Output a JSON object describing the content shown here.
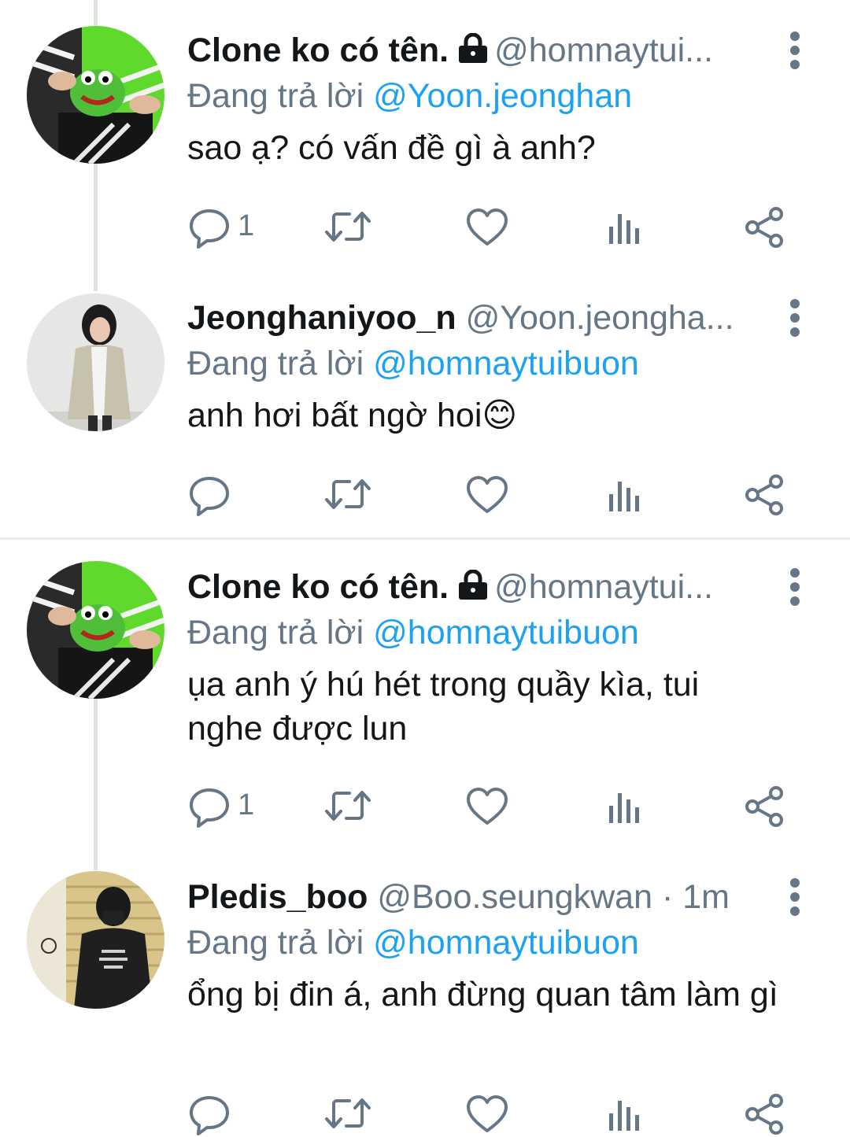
{
  "tweets": [
    {
      "display_name": "Clone ko có tên.",
      "locked": true,
      "handle": "@homnaytui...",
      "reply_prefix": "Đang trả lời",
      "reply_mention": "@Yoon.jeonghan",
      "text": "sao ạ? có vấn đề gì à anh?",
      "reply_count": "1",
      "avatar": "kermit-frog-avatar"
    },
    {
      "display_name": "Jeonghaniyoo_n",
      "locked": false,
      "handle": "@Yoon.jeongha...",
      "reply_prefix": "Đang trả lời",
      "reply_mention": "@homnaytuibuon",
      "text": "anh hơi bất ngờ hoi😊",
      "reply_count": "",
      "avatar": "person-cardigan-avatar"
    },
    {
      "display_name": "Clone ko có tên.",
      "locked": true,
      "handle": "@homnaytui...",
      "reply_prefix": "Đang trả lời",
      "reply_mention": "@homnaytuibuon",
      "text": "ụa anh ý hú hét trong quầy kìa, tui nghe được lun",
      "reply_count": "1",
      "avatar": "kermit-frog-avatar"
    },
    {
      "display_name": "Pledis_boo",
      "locked": false,
      "handle": "@Boo.seungkwan · 1m",
      "reply_prefix": "Đang trả lời",
      "reply_mention": "@homnaytuibuon",
      "text": "ổng bị đin á, anh đừng quan tâm làm gì",
      "reply_count": "",
      "avatar": "person-mask-avatar"
    }
  ],
  "icons": {
    "reply": "speech-bubble-icon",
    "retweet": "retweet-icon",
    "like": "heart-icon",
    "analytics": "bar-chart-icon",
    "share": "share-icon",
    "menu": "more-vertical-icon",
    "lock": "lock-icon"
  },
  "colors": {
    "name": "#14171a",
    "secondary": "#657786",
    "mention": "#1da1f2",
    "divider": "#e6ecf0"
  }
}
